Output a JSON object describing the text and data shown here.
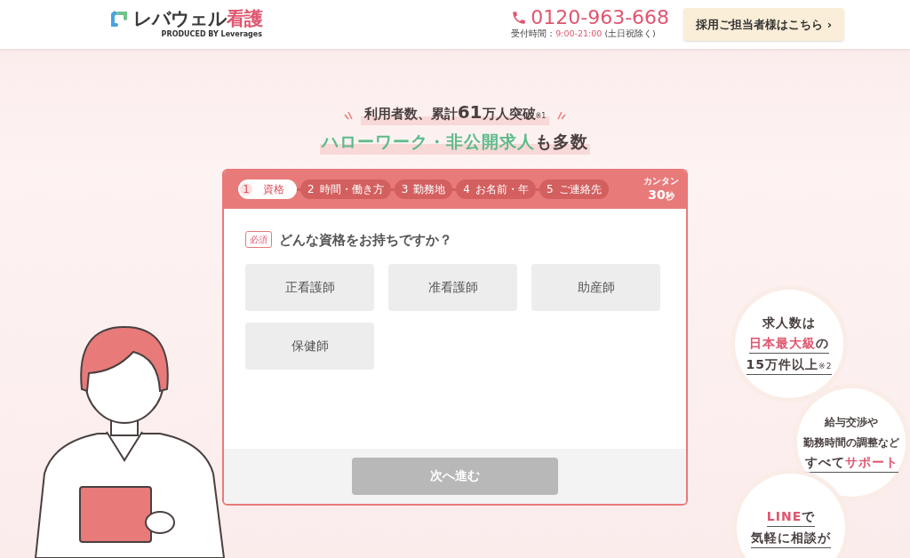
{
  "header": {
    "logo": {
      "name": "レバウェル",
      "accent": "看護",
      "produced_by": "PRODUCED BY Leverages"
    },
    "phone": {
      "number": "0120-963-668",
      "hours_label": "受付時間：",
      "hours": "9:00-21:00",
      "hours_note": "(土日祝除く)"
    },
    "cta": "採用ご担当者様はこちら ›"
  },
  "headline": {
    "line1": [
      {
        "text": "利用者数、累計",
        "kind": "plain"
      },
      {
        "text": "61",
        "kind": "big"
      },
      {
        "text": "万人突破",
        "kind": "plain"
      },
      {
        "text": "※1",
        "kind": "note"
      }
    ],
    "line2": [
      {
        "text": "ハローワーク・非公開求人",
        "kind": "accent"
      },
      {
        "text": "も多数",
        "kind": "plain"
      }
    ]
  },
  "form": {
    "steps": [
      {
        "number": "1",
        "label": "資格",
        "selected": true
      },
      {
        "number": "2",
        "label": "時間・働き方",
        "selected": false
      },
      {
        "number": "3",
        "label": "勤務地",
        "selected": false
      },
      {
        "number": "4",
        "label": "お名前・年",
        "selected": false
      },
      {
        "number": "5",
        "label": "ご連絡先",
        "selected": false
      }
    ],
    "time_badge": {
      "top": "カンタン",
      "number": "30",
      "unit": "秒"
    },
    "required": "必須",
    "question": "どんな資格をお持ちですか？",
    "options": [
      {
        "label": "正看護師",
        "selected": false
      },
      {
        "label": "准看護師",
        "selected": false
      },
      {
        "label": "助産師",
        "selected": false
      },
      {
        "label": "保健師",
        "selected": false
      }
    ],
    "next_button": {
      "label": "次へ進む",
      "disabled": true
    }
  },
  "bubbles": [
    {
      "lines": [
        [
          {
            "text": "求人数は",
            "kind": "plain"
          }
        ],
        [
          {
            "text": "日本最大級",
            "kind": "accent"
          },
          {
            "text": "の",
            "kind": "plain"
          }
        ],
        [
          {
            "text": "15万件以上",
            "kind": "plain"
          },
          {
            "text": "※2",
            "kind": "note"
          }
        ]
      ]
    },
    {
      "lines": [
        [
          {
            "text": "給与交渉や",
            "kind": "small"
          }
        ],
        [
          {
            "text": "勤務時間の調整など",
            "kind": "small"
          }
        ],
        [
          {
            "text": "すべて",
            "kind": "plain"
          },
          {
            "text": "サポート",
            "kind": "accent"
          }
        ]
      ]
    },
    {
      "lines": [
        [
          {
            "text": "LINE",
            "kind": "accent"
          },
          {
            "text": "で",
            "kind": "plain"
          }
        ],
        [
          {
            "text": "気軽に相談が",
            "kind": "plain"
          }
        ]
      ]
    }
  ]
}
